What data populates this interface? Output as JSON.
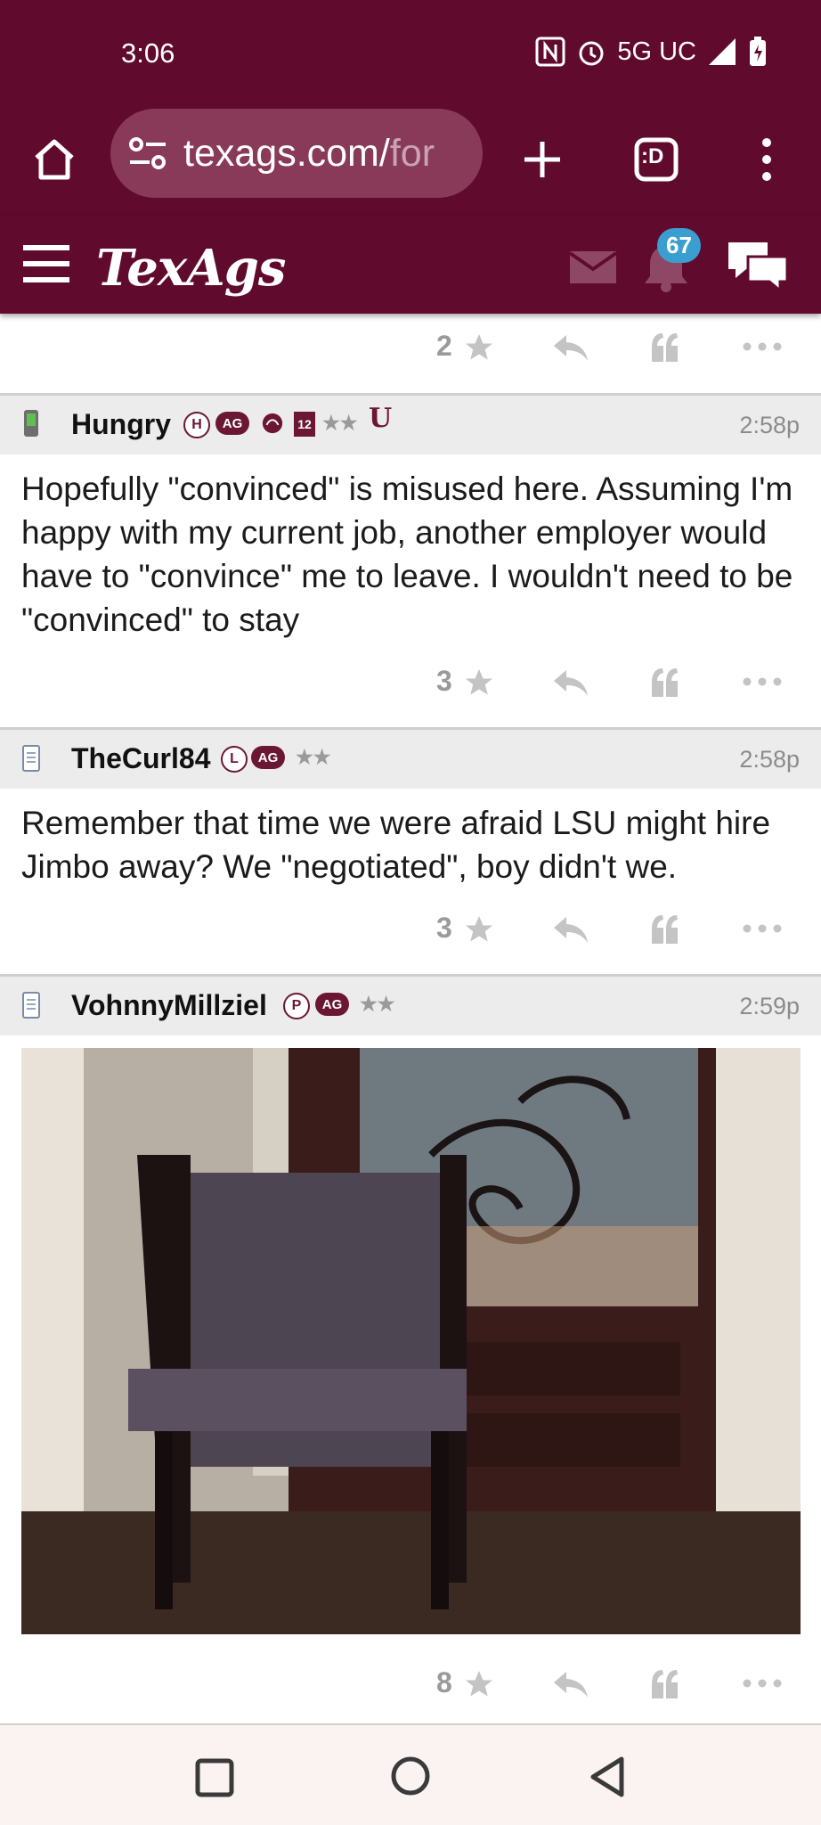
{
  "status_bar": {
    "time": "3:06",
    "network": "5G UC"
  },
  "browser": {
    "url_main": "texags.com/",
    "url_rest": "for",
    "tab_switcher_label": ":D"
  },
  "site": {
    "logo": "TexAgs",
    "notification_count": "67"
  },
  "posts": [
    {
      "likes": "2"
    },
    {
      "username": "Hungry",
      "time": "2:58p",
      "tags": {
        "badge_letter": "H",
        "ag": "AG",
        "twelve": "12",
        "stars": "★★",
        "u": "U"
      },
      "text": "Hopefully \"convinced\" is misused here. Assuming I'm happy with my current job, another employer would have to \"convince\" me to leave. I wouldn't need to be \"convinced\" to stay",
      "likes": "3"
    },
    {
      "username": "TheCurl84",
      "time": "2:58p",
      "tags": {
        "badge_letter": "L",
        "ag": "AG",
        "stars": "★★"
      },
      "text": "Remember that time we were afraid LSU might hire Jimbo away? We \"negotiated\", boy didn't we.",
      "likes": "3"
    },
    {
      "username": "VohnnyMillziel",
      "time": "2:59p",
      "tags": {
        "badge_letter": "P",
        "ag": "AG",
        "stars": "★★"
      },
      "likes": "8"
    }
  ],
  "colors": {
    "maroon": "#600b2d",
    "badge_blue": "#3a9fd0",
    "header_gray": "#ececec"
  }
}
